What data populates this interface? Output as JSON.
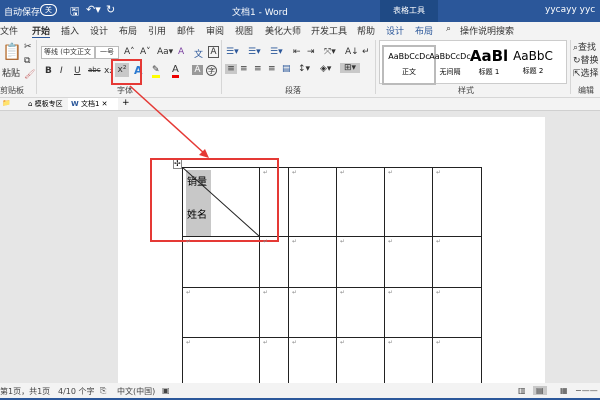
{
  "title_bar": {
    "autosave": "自动保存",
    "autosave_state": "关",
    "doc_title": "文档1  -  Word",
    "table_tools": "表格工具",
    "user": "yycayy yyc"
  },
  "menu": [
    "文件",
    "开始",
    "插入",
    "设计",
    "布局",
    "引用",
    "邮件",
    "审阅",
    "视图",
    "美化大师",
    "开发工具",
    "帮助",
    "设计",
    "布局"
  ],
  "search": "操作说明搜索",
  "ribbon": {
    "clipboard": {
      "paste": "粘贴",
      "label": "剪贴板"
    },
    "font": {
      "name": "等线 (中文正文",
      "size": "一号",
      "label": "字体",
      "bold": "B",
      "italic": "I",
      "underline": "U",
      "strike": "abc",
      "sub": "x₂",
      "sup": "x²"
    },
    "paragraph": {
      "label": "段落"
    },
    "styles": {
      "label": "样式",
      "items": [
        {
          "preview": "AaBbCcDc",
          "name": "正文"
        },
        {
          "preview": "AaBbCcDc",
          "name": "无间隔"
        },
        {
          "preview": "AaBl",
          "name": "标题 1"
        },
        {
          "preview": "AaBbC",
          "name": "标题 2"
        }
      ]
    },
    "editing": {
      "label": "编辑",
      "find": "查找",
      "replace": "替换",
      "select": "选择"
    }
  },
  "doc_tabs": {
    "template": "模板专区",
    "doc": "文档1"
  },
  "table": {
    "cell_top": "销量",
    "cell_bottom": "姓名"
  },
  "status": {
    "page": "第1页，共1页",
    "words": "4/10 个字",
    "lang": "中文(中国)"
  },
  "colors": {
    "accent": "#2b579a",
    "highlight": "#e53935"
  }
}
